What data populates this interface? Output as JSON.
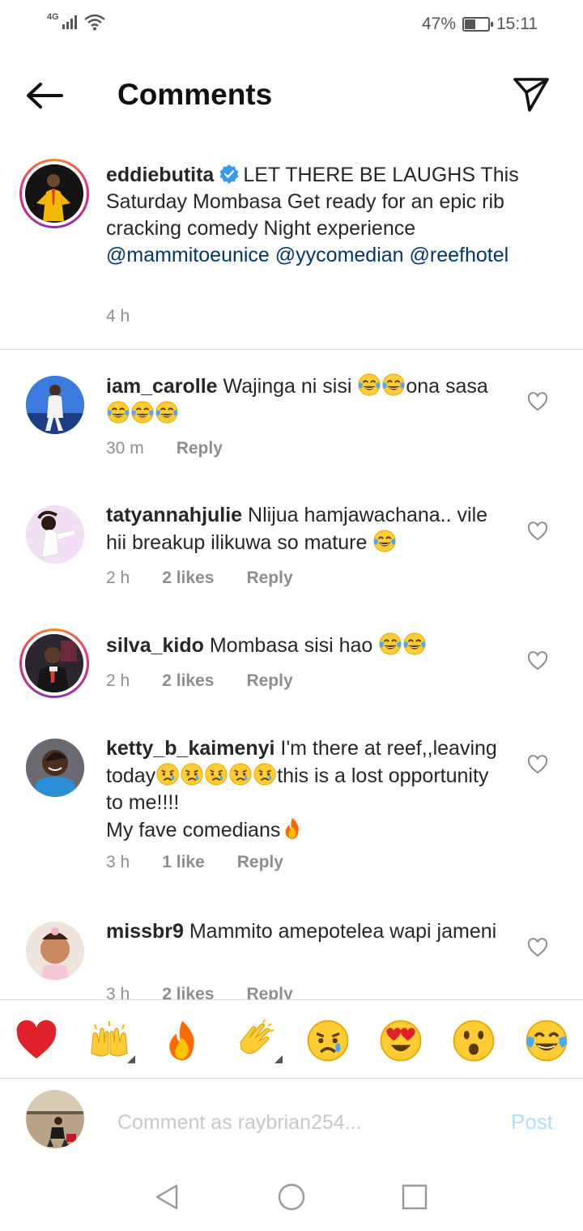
{
  "status_bar": {
    "network": "4G",
    "battery_percent_label": "47%",
    "battery_level": 0.47,
    "time": "15:11"
  },
  "header": {
    "title": "Comments"
  },
  "caption": {
    "username": "eddiebutita",
    "text": "LET THERE BE LAUGHS This Saturday Mombasa Get ready for an epic rib cracking comedy Night  experience",
    "mentions": [
      "@mammitoeunice",
      "@yycomedian",
      "@reefhotel"
    ],
    "time": "4 h"
  },
  "comments": [
    {
      "username": "iam_carolle",
      "text_a": "Wajinga ni sisi ",
      "text_b": "ona sasa",
      "time": "30 m",
      "likes": "",
      "reply": "Reply"
    },
    {
      "username": "tatyannahjulie",
      "text_a": "Nlijua hamjawachana.. vile hii breakup ilikuwa so mature ",
      "time": "2 h",
      "likes": "2 likes",
      "reply": "Reply"
    },
    {
      "username": "silva_kido",
      "text_a": "Mombasa sisi hao ",
      "time": "2 h",
      "likes": "2 likes",
      "reply": "Reply"
    },
    {
      "username": "ketty_b_kaimenyi",
      "text_a": "I'm there at reef,,leaving today",
      "text_b": "this is a lost opportunity to me!!!!",
      "text_c": "My fave comedians",
      "time": "3 h",
      "likes": "1 like",
      "reply": "Reply"
    },
    {
      "username": "missbr9",
      "text_a": "Mammito amepotelea wapi jameni",
      "time": "3 h",
      "likes": "2 likes",
      "reply": "Reply"
    }
  ],
  "emoji_bar": [
    "red-heart",
    "raising-hands",
    "fire",
    "clapping-hands",
    "crying-face",
    "heart-eyes",
    "surprised-face",
    "tears-of-joy"
  ],
  "comment_input": {
    "placeholder": "Comment as raybrian254...",
    "post_label": "Post"
  },
  "colors": {
    "mention": "#00376b",
    "meta": "#8e8e8e",
    "post_disabled": "#b2dffc",
    "verified": "#3897f0"
  }
}
